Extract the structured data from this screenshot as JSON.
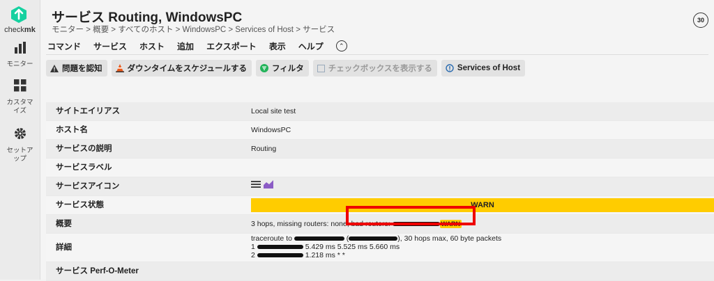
{
  "sidebar": {
    "brand": {
      "part1": "check",
      "part2": "mk"
    },
    "items": [
      {
        "label": "モニター",
        "icon": "monitor-bars-icon"
      },
      {
        "label": "カスタマイズ",
        "icon": "customize-grid-icon"
      },
      {
        "label": "セットアップ",
        "icon": "setup-gear-icon"
      }
    ]
  },
  "header": {
    "title": "サービス Routing, WindowsPC",
    "breadcrumb": "モニター > 概要 > すべてのホスト > WindowsPC > Services of Host > サービス",
    "refresh": "30"
  },
  "menu": [
    "コマンド",
    "サービス",
    "ホスト",
    "追加",
    "エクスポート",
    "表示",
    "ヘルプ"
  ],
  "toolbar": {
    "ack": "問題を認知",
    "downtime": "ダウンタイムをスケジュールする",
    "filter": "フィルタ",
    "checkboxes": "チェックボックスを表示する",
    "services_of_host": "Services of Host"
  },
  "table": {
    "site_alias": {
      "label": "サイトエイリアス",
      "value": "Local site test"
    },
    "host_name": {
      "label": "ホスト名",
      "value": "WindowsPC"
    },
    "service_desc": {
      "label": "サービスの説明",
      "value": "Routing"
    },
    "service_labels": {
      "label": "サービスラベル"
    },
    "service_icons": {
      "label": "サービスアイコン"
    },
    "service_state": {
      "label": "サービス状態",
      "value": "WARN"
    },
    "summary": {
      "label": "概要",
      "text1": "3 hops, missing routers: none, bad routers:",
      "badge": "WARN"
    },
    "details": {
      "label": "詳細",
      "line1a": "traceroute to",
      "line1b": "(",
      "line1c": "), 30 hops max, 60 byte packets",
      "line2a": "1",
      "line2b": "5.429 ms 5.525 ms 5.660 ms",
      "line3a": "2",
      "line3b": "1.218 ms * *"
    },
    "perf": {
      "label": "サービス Perf-O-Meter"
    }
  },
  "colors": {
    "warn": "#ffcc00",
    "brand": "#15d1a0",
    "highlight": "#ee0000"
  }
}
